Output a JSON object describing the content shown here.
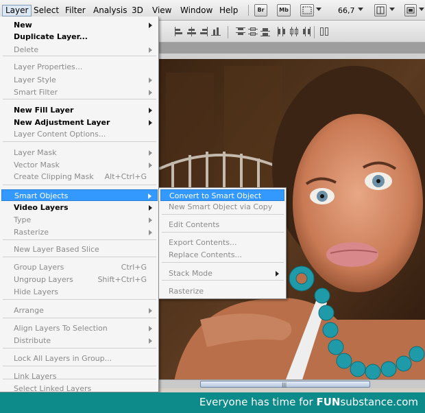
{
  "menubar": {
    "items": [
      "Layer",
      "Select",
      "Filter",
      "Analysis",
      "3D",
      "View",
      "Window",
      "Help"
    ],
    "bridge_label": "Br",
    "minibridge_label": "Mb",
    "zoom": "66,7"
  },
  "layer_menu": {
    "items": [
      {
        "label": "New",
        "state": "bold",
        "submenu": true,
        "shortcut": ""
      },
      {
        "label": "Duplicate Layer...",
        "state": "bold",
        "submenu": false,
        "shortcut": ""
      },
      {
        "label": "Delete",
        "state": "disabled",
        "submenu": true,
        "shortcut": ""
      },
      {
        "label": "Layer Properties...",
        "state": "disabled",
        "submenu": false,
        "shortcut": ""
      },
      {
        "label": "Layer Style",
        "state": "disabled",
        "submenu": true,
        "shortcut": ""
      },
      {
        "label": "Smart Filter",
        "state": "disabled",
        "submenu": true,
        "shortcut": ""
      },
      {
        "label": "New Fill Layer",
        "state": "bold",
        "submenu": true,
        "shortcut": ""
      },
      {
        "label": "New Adjustment Layer",
        "state": "bold",
        "submenu": true,
        "shortcut": ""
      },
      {
        "label": "Layer Content Options...",
        "state": "disabled",
        "submenu": false,
        "shortcut": ""
      },
      {
        "label": "Layer Mask",
        "state": "disabled",
        "submenu": true,
        "shortcut": ""
      },
      {
        "label": "Vector Mask",
        "state": "disabled",
        "submenu": true,
        "shortcut": ""
      },
      {
        "label": "Create Clipping Mask",
        "state": "disabled",
        "submenu": false,
        "shortcut": "Alt+Ctrl+G"
      },
      {
        "label": "Smart Objects",
        "state": "selected",
        "submenu": true,
        "shortcut": ""
      },
      {
        "label": "Video Layers",
        "state": "bold",
        "submenu": true,
        "shortcut": ""
      },
      {
        "label": "Type",
        "state": "disabled",
        "submenu": true,
        "shortcut": ""
      },
      {
        "label": "Rasterize",
        "state": "disabled",
        "submenu": true,
        "shortcut": ""
      },
      {
        "label": "New Layer Based Slice",
        "state": "disabled",
        "submenu": false,
        "shortcut": ""
      },
      {
        "label": "Group Layers",
        "state": "disabled",
        "submenu": false,
        "shortcut": "Ctrl+G"
      },
      {
        "label": "Ungroup Layers",
        "state": "disabled",
        "submenu": false,
        "shortcut": "Shift+Ctrl+G"
      },
      {
        "label": "Hide Layers",
        "state": "disabled",
        "submenu": false,
        "shortcut": ""
      },
      {
        "label": "Arrange",
        "state": "disabled",
        "submenu": true,
        "shortcut": ""
      },
      {
        "label": "Align Layers To Selection",
        "state": "disabled",
        "submenu": true,
        "shortcut": ""
      },
      {
        "label": "Distribute",
        "state": "disabled",
        "submenu": true,
        "shortcut": ""
      },
      {
        "label": "Lock All Layers in Group...",
        "state": "disabled",
        "submenu": false,
        "shortcut": ""
      },
      {
        "label": "Link Layers",
        "state": "disabled",
        "submenu": false,
        "shortcut": ""
      },
      {
        "label": "Select Linked Layers",
        "state": "disabled",
        "submenu": false,
        "shortcut": ""
      }
    ]
  },
  "smart_objects_submenu": {
    "items": [
      {
        "label": "Convert to Smart Object",
        "state": "selected",
        "submenu": false
      },
      {
        "label": "New Smart Object via Copy",
        "state": "disabled",
        "submenu": false
      },
      {
        "label": "Edit Contents",
        "state": "disabled",
        "submenu": false
      },
      {
        "label": "Export Contents...",
        "state": "disabled",
        "submenu": false
      },
      {
        "label": "Replace Contents...",
        "state": "disabled",
        "submenu": false
      },
      {
        "label": "Stack Mode",
        "state": "disabled",
        "submenu": true
      },
      {
        "label": "Rasterize",
        "state": "disabled",
        "submenu": false
      }
    ]
  },
  "footer": {
    "prefix": "Everyone has time for",
    "brand_bold": "FUN",
    "brand_rest": "substance.com"
  },
  "colors": {
    "highlight": "#3399ff",
    "footer_bg": "#0d8a8a",
    "necklace": "#1f9aa8"
  }
}
